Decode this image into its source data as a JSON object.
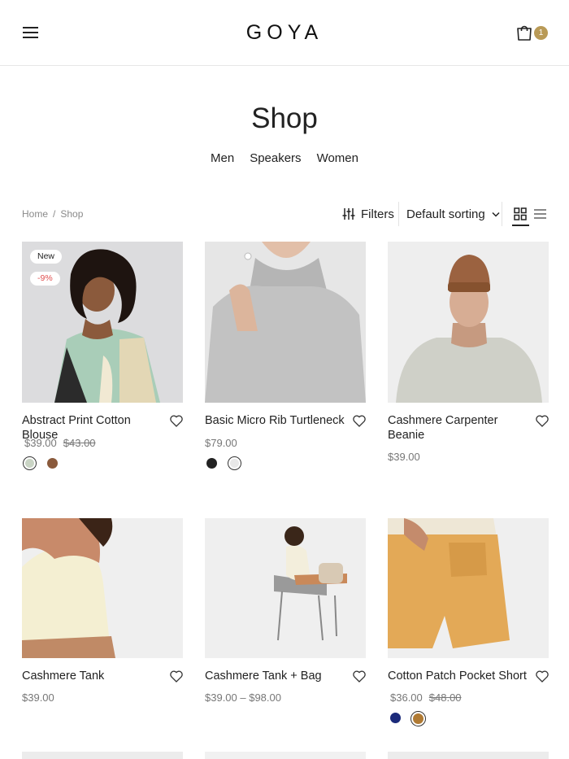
{
  "header": {
    "logo": "GOYA",
    "cart_count": "1"
  },
  "page": {
    "title": "Shop",
    "categories": [
      "Men",
      "Speakers",
      "Women"
    ]
  },
  "breadcrumb": {
    "home": "Home",
    "separator": "/",
    "current": "Shop"
  },
  "toolbar": {
    "filters_label": "Filters",
    "sorting_label": "Default sorting"
  },
  "colors": {
    "accent": "#b99a57",
    "sale": "#e04e4e"
  },
  "products": [
    {
      "name": "Abstract Print Cotton Blouse",
      "price": "$39.00",
      "old_price": "$43.00",
      "badge_new": "New",
      "badge_sale": "-9%",
      "swatches": [
        "#c9d4c4",
        "#8a5a3c"
      ]
    },
    {
      "name": "Basic Micro Rib Turtleneck",
      "price": "$79.00",
      "swatches": [
        "#222222",
        "#e8e8e8"
      ]
    },
    {
      "name": "Cashmere Carpenter Beanie",
      "price": "$39.00"
    },
    {
      "name": "Cashmere Tank",
      "price": "$39.00"
    },
    {
      "name": "Cashmere Tank + Bag",
      "price": "$39.00 – $98.00"
    },
    {
      "name": "Cotton Patch Pocket Short",
      "price": "$36.00",
      "old_price": "$48.00",
      "swatches": [
        "#1b2a7a",
        "#b07a33"
      ]
    }
  ]
}
